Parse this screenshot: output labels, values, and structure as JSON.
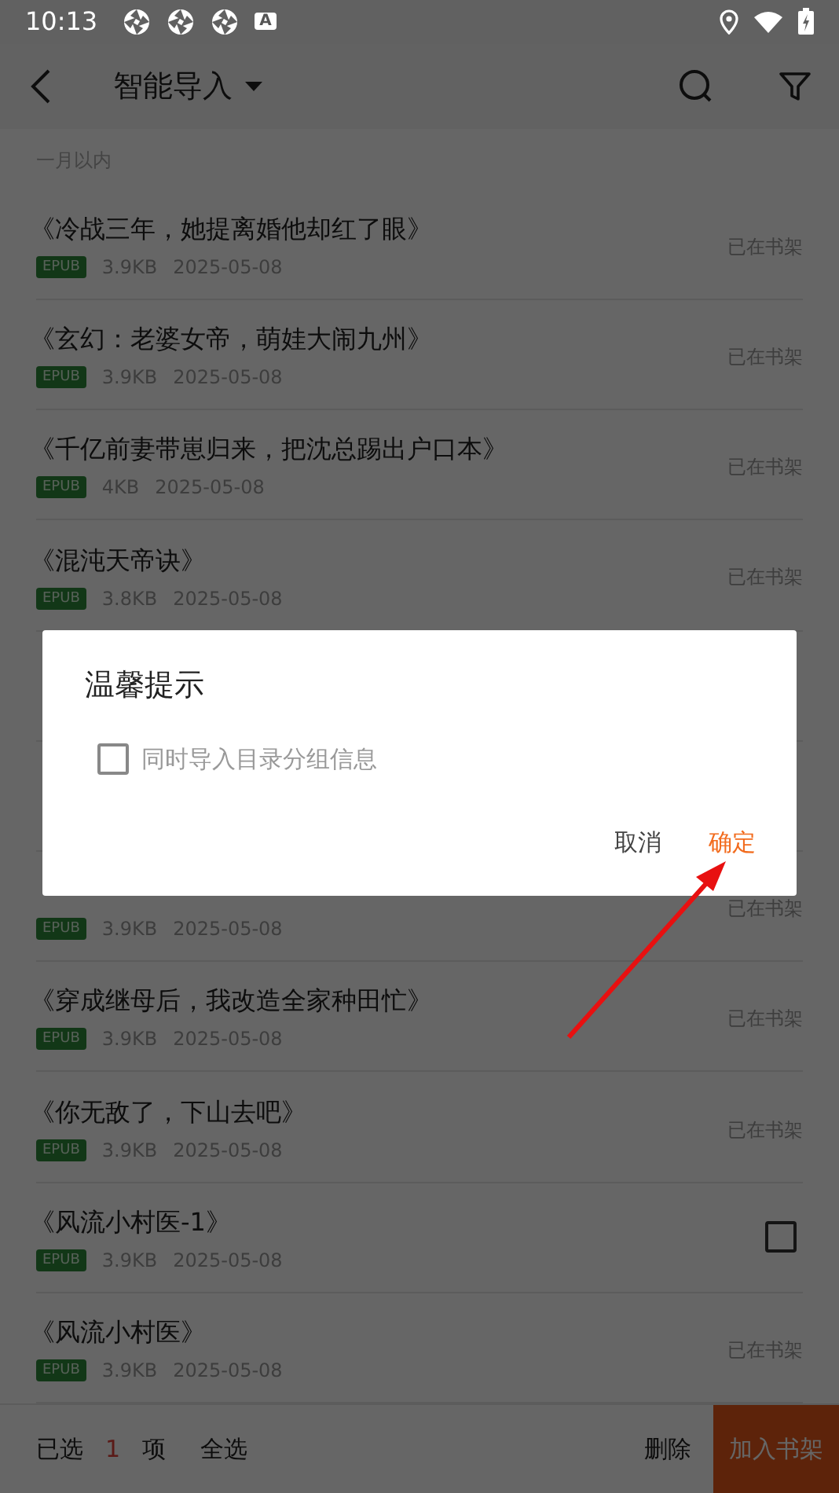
{
  "status_bar": {
    "time": "10:13",
    "badge": "A"
  },
  "toolbar": {
    "title": "智能导入"
  },
  "section": "一月以内",
  "books": [
    {
      "title": "《冷战三年，她提离婚他却红了眼》",
      "format": "EPUB",
      "size": "3.9KB",
      "date": "2025-05-08",
      "kind": "status",
      "status": "已在书架"
    },
    {
      "title": "《玄幻：老婆女帝，萌娃大闹九州》",
      "format": "EPUB",
      "size": "3.9KB",
      "date": "2025-05-08",
      "kind": "status",
      "status": "已在书架"
    },
    {
      "title": "《千亿前妻带崽归来，把沈总踢出户口本》",
      "format": "EPUB",
      "size": "4KB",
      "date": "2025-05-08",
      "kind": "status",
      "status": "已在书架"
    },
    {
      "title": "《混沌天帝诀》",
      "format": "EPUB",
      "size": "3.8KB",
      "date": "2025-05-08",
      "kind": "status",
      "status": "已在书架"
    },
    {
      "kind": "covered"
    },
    {
      "kind": "covered"
    },
    {
      "format": "EPUB",
      "size": "3.9KB",
      "date": "2025-05-08",
      "kind": "status",
      "status": "已在书架"
    },
    {
      "title": "《穿成继母后，我改造全家种田忙》",
      "format": "EPUB",
      "size": "3.9KB",
      "date": "2025-05-08",
      "kind": "status",
      "status": "已在书架"
    },
    {
      "title": "《你无敌了，下山去吧》",
      "format": "EPUB",
      "size": "3.9KB",
      "date": "2025-05-08",
      "kind": "status",
      "status": "已在书架"
    },
    {
      "title": "《风流小村医-1》",
      "format": "EPUB",
      "size": "3.9KB",
      "date": "2025-05-08",
      "kind": "checkbox",
      "checked": false
    },
    {
      "title": "《风流小村医》",
      "format": "EPUB",
      "size": "3.9KB",
      "date": "2025-05-08",
      "kind": "status",
      "status": "已在书架"
    }
  ],
  "bottom_bar": {
    "selected_prefix": "已选",
    "selected_count": "1",
    "selected_suffix": "项",
    "select_all": "全选",
    "delete": "删除",
    "add": "加入书架"
  },
  "dialog": {
    "title": "温馨提示",
    "option": {
      "label": "同时导入目录分组信息",
      "checked": false
    },
    "cancel": "取消",
    "confirm": "确定"
  }
}
